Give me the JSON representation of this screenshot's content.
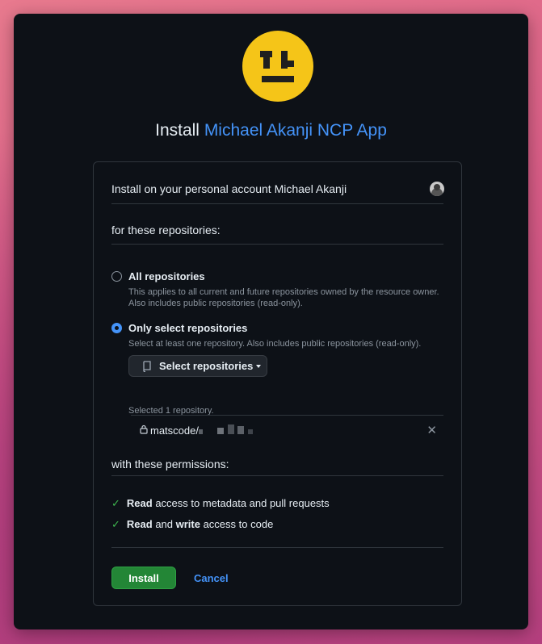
{
  "header": {
    "title_prefix": "Install",
    "app_name": "Michael Akanji NCP App"
  },
  "account": {
    "label": "Install on your personal account Michael Akanji"
  },
  "repositories": {
    "section_label": "for these repositories:",
    "all": {
      "title": "All repositories",
      "description": "This applies to all current and future repositories owned by the resource owner. Also includes public repositories (read-only).",
      "checked": false
    },
    "select": {
      "title": "Only select repositories",
      "description": "Select at least one repository. Also includes public repositories (read-only).",
      "checked": true
    },
    "select_button_label": "Select repositories",
    "selected_count_text": "Selected 1 repository.",
    "selected": [
      {
        "name": "matscode/"
      }
    ]
  },
  "permissions": {
    "section_label": "with these permissions:",
    "items": [
      {
        "bold1": "Read",
        "rest1": " access to metadata and pull requests",
        "bold2": "",
        "rest2": ""
      },
      {
        "bold1": "Read",
        "rest1": " and ",
        "bold2": "write",
        "rest2": " access to code"
      }
    ]
  },
  "actions": {
    "install_label": "Install",
    "cancel_label": "Cancel"
  },
  "colors": {
    "accent": "#4493f8",
    "install": "#238636",
    "logo": "#f5c518",
    "check": "#3fb950"
  },
  "icons": [
    "app-logo-icon",
    "repo-icon",
    "caret-down-icon",
    "lock-icon",
    "close-icon",
    "check-icon",
    "avatar"
  ]
}
